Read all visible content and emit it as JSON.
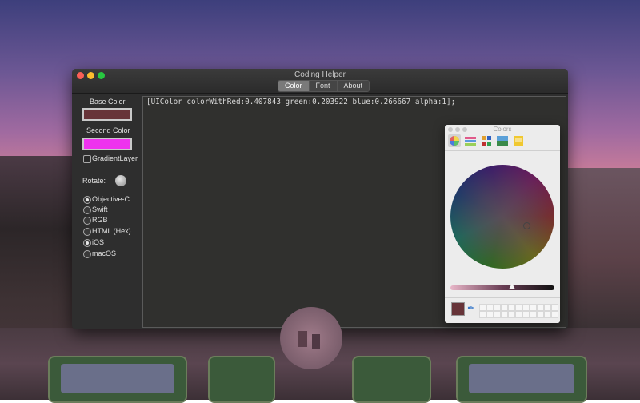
{
  "window": {
    "title": "Coding Helper",
    "tabs": [
      {
        "label": "Color",
        "selected": true
      },
      {
        "label": "Font",
        "selected": false
      },
      {
        "label": "About",
        "selected": false
      }
    ]
  },
  "sidebar": {
    "base_color_label": "Base Color",
    "base_color": "#673439",
    "second_color_label": "Second Color",
    "second_color": "#ee33ee",
    "gradient_label": "GradientLayer",
    "gradient_checked": false,
    "rotate_label": "Rotate:",
    "languages": [
      {
        "label": "Objective-C",
        "selected": true
      },
      {
        "label": "Swift",
        "selected": false
      },
      {
        "label": "RGB",
        "selected": false
      },
      {
        "label": "HTML (Hex)",
        "selected": false
      }
    ],
    "platforms": [
      {
        "label": "iOS",
        "selected": true
      },
      {
        "label": "macOS",
        "selected": false
      }
    ]
  },
  "editor": {
    "code": "[UIColor colorWithRed:0.407843 green:0.203922 blue:0.266667 alpha:1];"
  },
  "colors_panel": {
    "title": "Colors",
    "tabs": [
      "color-wheel-icon",
      "color-sliders-icon",
      "color-palettes-icon",
      "image-palettes-icon",
      "pencils-icon"
    ],
    "current_color": "#673439"
  }
}
